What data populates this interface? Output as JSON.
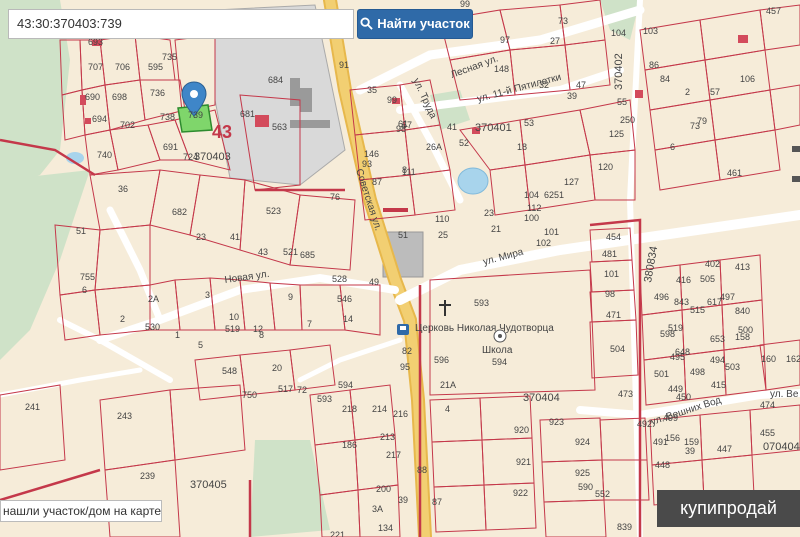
{
  "search": {
    "value": "43:30:370403:739",
    "button_label": "Найти участок"
  },
  "help_link": "нашли участок/дом на карте?",
  "watermark": "купипродай",
  "colors": {
    "background": "#f6ecd9",
    "parcel_border": "#c4384a",
    "forest": "#cfe2c8",
    "road": "#ffffff",
    "main_road": "#f2cf72",
    "selected_parcel": "#7fd66b",
    "marker": "#3f86c8",
    "button": "#2f6aa8"
  },
  "icons": {
    "marker": "map-pin-icon",
    "search": "search-icon",
    "church": "cross-icon",
    "school": "school-icon",
    "bus": "bus-stop-icon"
  },
  "quarters": [
    "43",
    "370403",
    "370401",
    "370402",
    "370404",
    "370405",
    "070404",
    "380834"
  ],
  "streets": [
    "Лесная ул.",
    "ул. Труда",
    "ул. 11-й Пятилетки",
    "Советская ул.",
    "ул. Мира",
    "Новая ул.",
    "ул. Вешних Вод",
    "ул. Ве"
  ],
  "places": [
    "Церковь Николая Чудотворца",
    "Школа"
  ],
  "labels": [
    "693",
    "707",
    "706",
    "595",
    "735",
    "690",
    "698",
    "736",
    "694",
    "702",
    "738",
    "739",
    "740",
    "691",
    "724",
    "684",
    "681",
    "563",
    "76",
    "36",
    "682",
    "23",
    "41",
    "43",
    "521",
    "685",
    "523",
    "528",
    "49",
    "51",
    "2А",
    "530",
    "755",
    "6",
    "2",
    "3",
    "1",
    "5",
    "519",
    "12",
    "10",
    "8",
    "9",
    "7",
    "14",
    "546",
    "548",
    "20",
    "517",
    "750",
    "72",
    "593",
    "594",
    "186",
    "218",
    "214",
    "216",
    "213",
    "217",
    "241",
    "243",
    "239",
    "221",
    "200",
    "3А",
    "134",
    "39",
    "88",
    "87",
    "82",
    "95",
    "91",
    "35",
    "99",
    "98",
    "61",
    "57",
    "146",
    "93",
    "87",
    "8",
    "111",
    "110",
    "51",
    "25",
    "23",
    "21",
    "112",
    "26А",
    "97",
    "73",
    "99",
    "32",
    "148",
    "27",
    "39",
    "47",
    "53",
    "41",
    "52",
    "55",
    "120",
    "125",
    "127",
    "6251",
    "250",
    "104",
    "18",
    "104",
    "100",
    "101",
    "102",
    "103",
    "86",
    "84",
    "106",
    "57",
    "2",
    "79",
    "73",
    "6",
    "457",
    "461",
    "454",
    "481",
    "101",
    "98",
    "471",
    "504",
    "593",
    "594",
    "596",
    "21А",
    "4",
    "920",
    "921",
    "922",
    "923",
    "924",
    "925",
    "590",
    "552",
    "839",
    "473",
    "474",
    "455",
    "448",
    "447",
    "39",
    "449",
    "450",
    "415",
    "519",
    "598",
    "515",
    "843",
    "617",
    "648",
    "653",
    "840",
    "505",
    "416",
    "402",
    "413",
    "496",
    "497",
    "495",
    "494",
    "500",
    "498",
    "503",
    "501",
    "499",
    "492",
    "491",
    "156",
    "159",
    "160",
    "162",
    "158",
    "164",
    "155",
    "161",
    "488",
    "508",
    "509",
    "510",
    "507",
    "511",
    "506",
    "618",
    "639",
    "540"
  ]
}
